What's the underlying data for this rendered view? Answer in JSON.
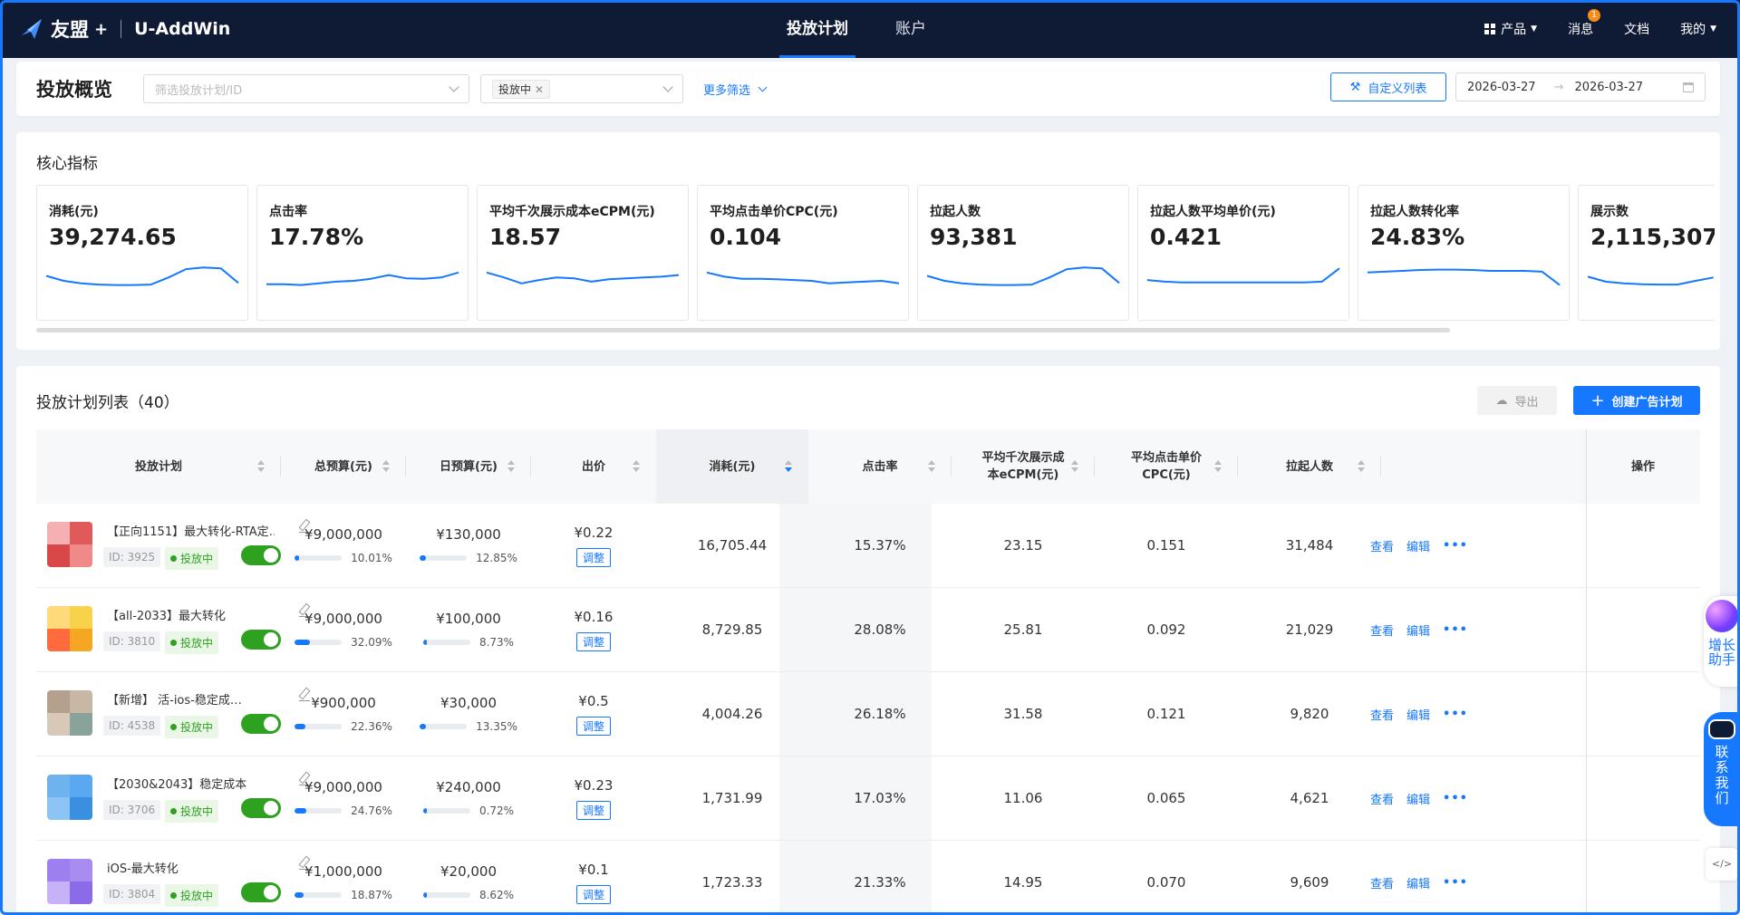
{
  "header": {
    "brand": "友盟",
    "plus": "+",
    "app_name": "U-AddWin",
    "tabs": [
      {
        "label": "投放计划",
        "active": true
      },
      {
        "label": "账户",
        "active": false
      }
    ],
    "right": {
      "product": "产品",
      "messages": "消息",
      "message_badge": "1",
      "docs": "文档",
      "mine": "我的"
    }
  },
  "filters": {
    "page_title": "投放概览",
    "plan_placeholder": "筛选投放计划/ID",
    "status_tag": "投放中",
    "more_filters": "更多筛选",
    "custom_list": "自定义列表",
    "date_start": "2026-03-27",
    "date_arrow": "→",
    "date_end": "2026-03-27"
  },
  "core": {
    "title": "核心指标",
    "metrics": [
      {
        "label": "消耗(元)",
        "value": "39,274.65",
        "trend": [
          62,
          50,
          44,
          41,
          40,
          40,
          41,
          58,
          78,
          82,
          80,
          45
        ]
      },
      {
        "label": "点击率",
        "value": "17.78%",
        "trend": [
          42,
          42,
          40,
          44,
          48,
          50,
          55,
          64,
          56,
          55,
          58,
          70
        ]
      },
      {
        "label": "平均千次展示成本eCPM(元)",
        "value": "18.57",
        "trend": [
          70,
          58,
          44,
          52,
          58,
          56,
          48,
          54,
          56,
          58,
          60,
          64
        ]
      },
      {
        "label": "平均点击单价CPC(元)",
        "value": "0.104",
        "trend": [
          70,
          60,
          55,
          55,
          54,
          52,
          50,
          44,
          46,
          48,
          50,
          44
        ]
      },
      {
        "label": "拉起人数",
        "value": "93,381",
        "trend": [
          62,
          50,
          44,
          41,
          40,
          40,
          41,
          58,
          78,
          82,
          80,
          45
        ]
      },
      {
        "label": "拉起人数平均单价(元)",
        "value": "0.421",
        "trend": [
          52,
          48,
          46,
          46,
          46,
          46,
          46,
          46,
          46,
          46,
          48,
          80
        ]
      },
      {
        "label": "拉起人数转化率",
        "value": "24.83%",
        "trend": [
          70,
          72,
          74,
          76,
          77,
          77,
          76,
          74,
          74,
          74,
          72,
          40
        ]
      },
      {
        "label": "展示数",
        "value": "2,115,307",
        "trend": [
          60,
          48,
          44,
          42,
          41,
          41,
          50,
          58
        ]
      }
    ]
  },
  "list": {
    "title": "投放计划列表（40）",
    "export": "导出",
    "create": "创建广告计划",
    "columns": [
      "投放计划",
      "总预算(元)",
      "日预算(元)",
      "出价",
      "消耗(元)",
      "点击率",
      "平均千次展示成本eCPM(元)",
      "平均点击单价CPC(元)",
      "拉起人数",
      "操作"
    ],
    "adjust": "调整",
    "ops": {
      "view": "查看",
      "edit": "编辑",
      "more": "•••"
    },
    "rows": [
      {
        "name": "【正向1151】最大转化-RTA定…",
        "id": "ID: 3925",
        "status": "投放中",
        "total_budget": "¥9,000,000",
        "total_pct": "10.01%",
        "total_frac": 0.1001,
        "daily_budget": "¥130,000",
        "daily_pct": "12.85%",
        "daily_frac": 0.1285,
        "bid": "¥0.22",
        "spend": "16,705.44",
        "ctr": "15.37%",
        "ecpm": "23.15",
        "cpc": "0.151",
        "launches": "31,484",
        "colors": [
          "#e05a5a",
          "#f08a8a",
          "#d94848",
          "#f5b1b1"
        ]
      },
      {
        "name": "【all-2033】最大转化",
        "id": "ID: 3810",
        "status": "投放中",
        "total_budget": "¥9,000,000",
        "total_pct": "32.09%",
        "total_frac": 0.3209,
        "daily_budget": "¥100,000",
        "daily_pct": "8.73%",
        "daily_frac": 0.0873,
        "bid": "¥0.16",
        "spend": "8,729.85",
        "ctr": "28.08%",
        "ecpm": "25.81",
        "cpc": "0.092",
        "launches": "21,029",
        "colors": [
          "#f7d24a",
          "#f5a623",
          "#ff6b3d",
          "#ffd97a"
        ]
      },
      {
        "name": "【新增】 活-ios-稳定成…",
        "id": "ID: 4538",
        "status": "投放中",
        "total_budget": "¥900,000",
        "total_pct": "22.36%",
        "total_frac": 0.2236,
        "daily_budget": "¥30,000",
        "daily_pct": "13.35%",
        "daily_frac": 0.1335,
        "bid": "¥0.5",
        "spend": "4,004.26",
        "ctr": "26.18%",
        "ecpm": "31.58",
        "cpc": "0.121",
        "launches": "9,820",
        "colors": [
          "#c9b7a6",
          "#8aa39a",
          "#d8c8b8",
          "#b5a08e"
        ]
      },
      {
        "name": "【2030&2043】稳定成本",
        "id": "ID: 3706",
        "status": "投放中",
        "total_budget": "¥9,000,000",
        "total_pct": "24.76%",
        "total_frac": 0.2476,
        "daily_budget": "¥240,000",
        "daily_pct": "0.72%",
        "daily_frac": 0.0072,
        "bid": "¥0.23",
        "spend": "1,731.99",
        "ctr": "17.03%",
        "ecpm": "11.06",
        "cpc": "0.065",
        "launches": "4,621",
        "colors": [
          "#5aa9f0",
          "#3b8fe0",
          "#8cc4f5",
          "#6fb3ee"
        ]
      },
      {
        "name": "iOS-最大转化",
        "id": "ID: 3804",
        "status": "投放中",
        "total_budget": "¥1,000,000",
        "total_pct": "18.87%",
        "total_frac": 0.1887,
        "daily_budget": "¥20,000",
        "daily_pct": "8.62%",
        "daily_frac": 0.0862,
        "bid": "¥0.1",
        "spend": "1,723.33",
        "ctr": "21.33%",
        "ecpm": "14.95",
        "cpc": "0.070",
        "launches": "9,609",
        "colors": [
          "#a98cf0",
          "#8b6be8",
          "#c6b2f7",
          "#9d7ff0"
        ]
      }
    ]
  },
  "float": {
    "assistant": "增长助手",
    "contact": "联系我们"
  },
  "colors": {
    "topbar": "#0f1b35",
    "accent": "#1677ff",
    "status_green": "#2ea121"
  }
}
